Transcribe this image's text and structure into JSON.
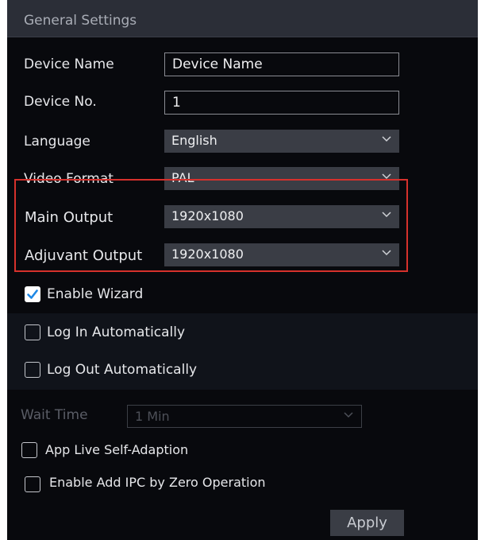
{
  "header": {
    "title": "General Settings"
  },
  "fields": {
    "device_name": {
      "label": "Device Name",
      "value": "Device Name"
    },
    "device_no": {
      "label": "Device No.",
      "value": "1"
    },
    "language": {
      "label": "Language",
      "value": "English"
    },
    "video_format": {
      "label": "Video Format",
      "value": "PAL"
    },
    "main_output": {
      "label": "Main Output",
      "value": "1920x1080"
    },
    "adjuvant_output": {
      "label": "Adjuvant Output",
      "value": "1920x1080"
    },
    "wait_time": {
      "label": "Wait Time",
      "value": "1 Min"
    }
  },
  "checkboxes": {
    "enable_wizard": {
      "label": "Enable Wizard",
      "checked": true
    },
    "log_in_auto": {
      "label": "Log In Automatically",
      "checked": false
    },
    "log_out_auto": {
      "label": "Log Out Automatically",
      "checked": false
    },
    "app_live_self_adaption": {
      "label": "App Live Self-Adaption",
      "checked": false
    },
    "enable_add_ipc": {
      "label": "Enable Add IPC by Zero Operation",
      "checked": false
    }
  },
  "apply_label": "Apply",
  "colors": {
    "panel_bg": "#08090d",
    "header_bg": "#2b2e37",
    "control_bg": "#3a3d45",
    "highlight_border": "#d6312c",
    "check_mark": "#1e88e5"
  },
  "icons": {
    "dropdown": "chevron-down-icon",
    "check": "check-icon"
  }
}
